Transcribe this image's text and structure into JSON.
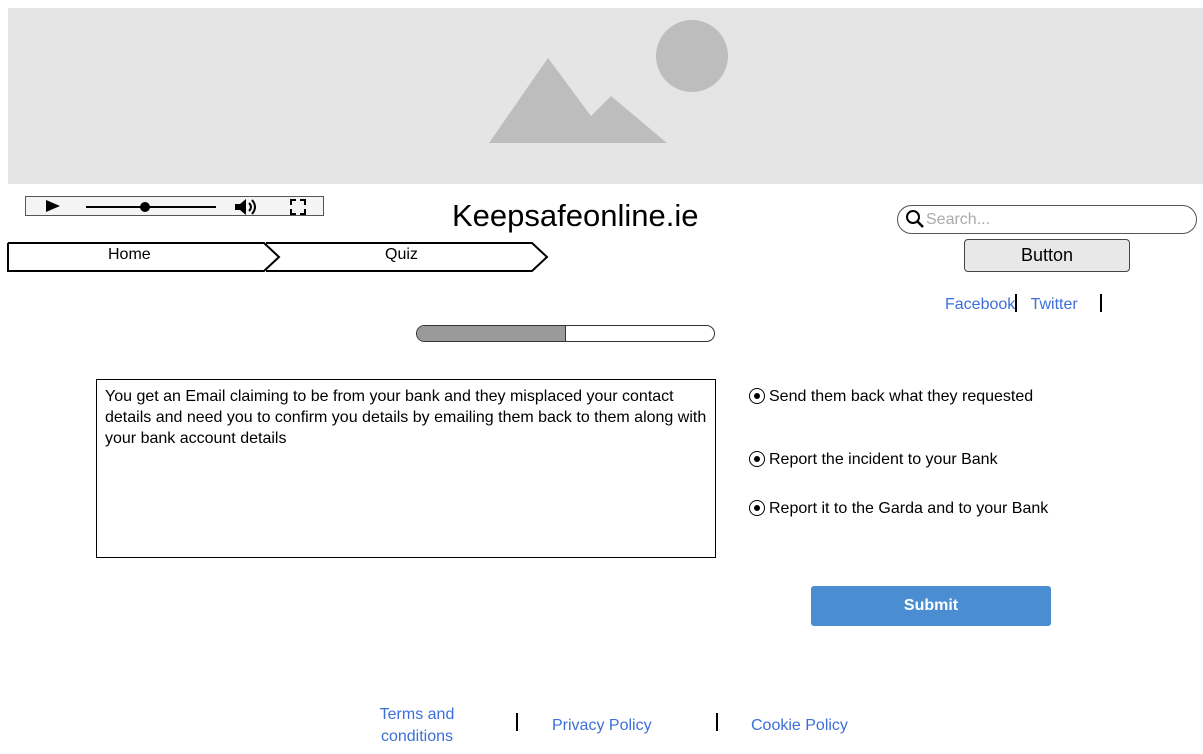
{
  "hero": {
    "icon": "image-placeholder-icon"
  },
  "player": {
    "progress": 0.45
  },
  "header": {
    "title": "Keepsafeonline.ie"
  },
  "search": {
    "placeholder": "Search..."
  },
  "top_button": {
    "label": "Button"
  },
  "breadcrumb": {
    "items": [
      {
        "label": "Home"
      },
      {
        "label": "Quiz"
      }
    ]
  },
  "social": {
    "facebook": "Facebook",
    "twitter": "Twitter"
  },
  "quiz": {
    "progress": 0.5,
    "question": "You get an Email claiming to be from your bank and they misplaced your contact details and need you to confirm you details by emailing them back to them along with your bank account details",
    "options": [
      {
        "label": "Send them back what they requested"
      },
      {
        "label": "Report the incident to your Bank"
      },
      {
        "label": "Report it to the Garda and to your Bank"
      }
    ],
    "submit_label": "Submit"
  },
  "footer": {
    "terms": "Terms and conditions",
    "privacy": "Privacy Policy",
    "cookie": "Cookie Policy"
  },
  "colors": {
    "link": "#3c6fd9",
    "submit": "#4a8ed1",
    "placeholder_bg": "#e5e5e5",
    "placeholder_icon": "#bdbdbd"
  }
}
